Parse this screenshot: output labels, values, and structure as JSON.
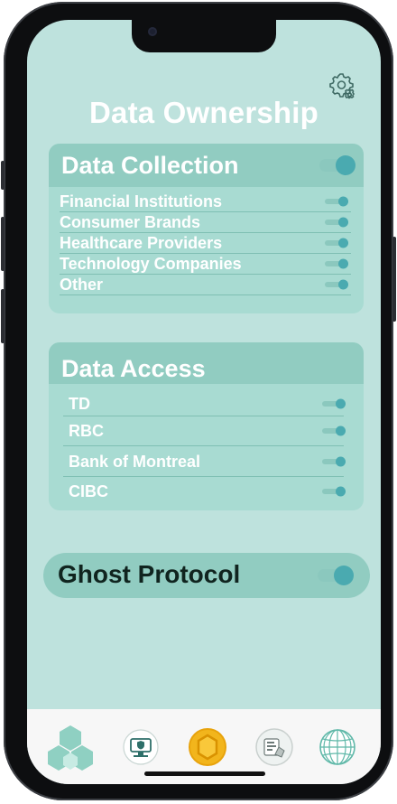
{
  "page": {
    "title": "Data Ownership"
  },
  "data_collection": {
    "title": "Data Collection",
    "enabled": true,
    "items": [
      {
        "label": "Financial Institutions",
        "enabled": true
      },
      {
        "label": "Consumer Brands",
        "enabled": true
      },
      {
        "label": "Healthcare Providers",
        "enabled": true
      },
      {
        "label": "Technology Companies",
        "enabled": true
      },
      {
        "label": "Other",
        "enabled": true
      }
    ]
  },
  "data_access": {
    "title": "Data Access",
    "items": [
      {
        "label": "TD",
        "enabled": true
      },
      {
        "label": "RBC",
        "enabled": true
      },
      {
        "label": "Bank of Montreal",
        "enabled": true
      },
      {
        "label": "CIBC",
        "enabled": true
      }
    ]
  },
  "ghost_protocol": {
    "label": "Ghost Protocol",
    "enabled": true
  },
  "nav": {
    "items": [
      {
        "icon": "hexagon-cluster-icon",
        "active": true
      },
      {
        "icon": "secure-monitor-icon",
        "active": false
      },
      {
        "icon": "gold-coin-hexagon-icon",
        "active": false
      },
      {
        "icon": "wallet-card-icon",
        "active": false
      },
      {
        "icon": "globe-network-icon",
        "active": false
      }
    ]
  },
  "colors": {
    "screen_bg": "#bee2dd",
    "card_bg": "#a8dbd2",
    "card_header_bg": "#91ccc1",
    "toggle_knob": "#4aaab0",
    "toggle_track": "#8bc8be",
    "bottom_bar_bg": "#f7f7f7"
  }
}
